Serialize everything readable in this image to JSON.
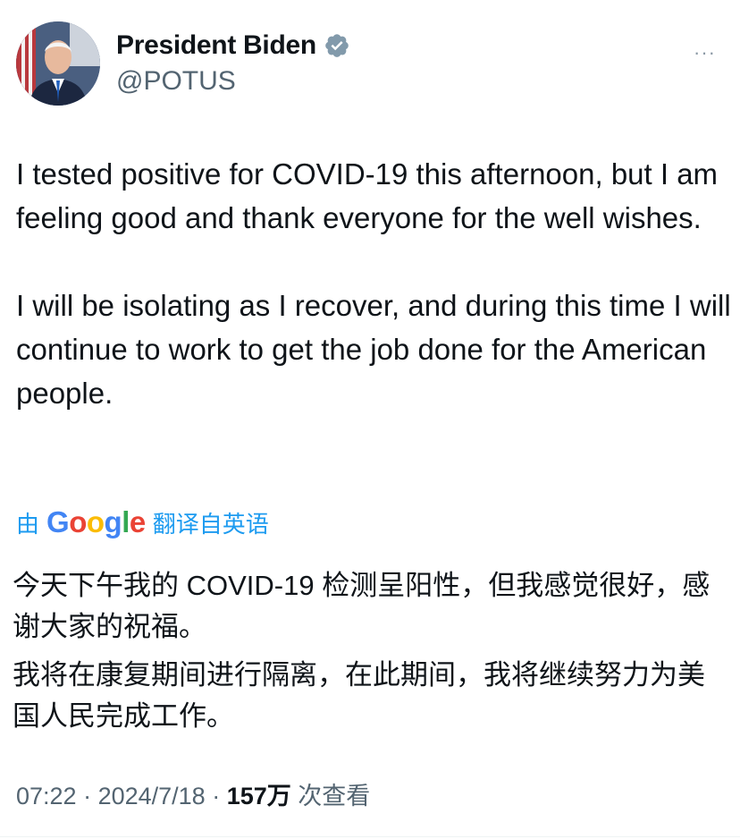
{
  "header": {
    "display_name": "President Biden",
    "handle": "@POTUS",
    "more": "···",
    "verified_color": "#829aab"
  },
  "tweet": {
    "paragraph_1": "I tested positive for COVID-19 this afternoon, but I am feeling good and thank everyone for the well wishes.",
    "paragraph_2": "I will be isolating as I recover, and during this time I will continue to work to get the job done for the American people."
  },
  "translation": {
    "prefix": "由",
    "provider": "Google",
    "suffix": "翻译自英语",
    "paragraph_1": "今天下午我的 COVID-19 检测呈阳性，但我感觉很好，感谢大家的祝福。",
    "paragraph_2": "我将在康复期间进行隔离，在此期间，我将继续努力为美国人民完成工作。"
  },
  "meta": {
    "time": "07:22",
    "sep1": " · ",
    "date": "2024/7/18",
    "sep2": " · ",
    "views_count": "157万",
    "views_label": " 次查看"
  }
}
